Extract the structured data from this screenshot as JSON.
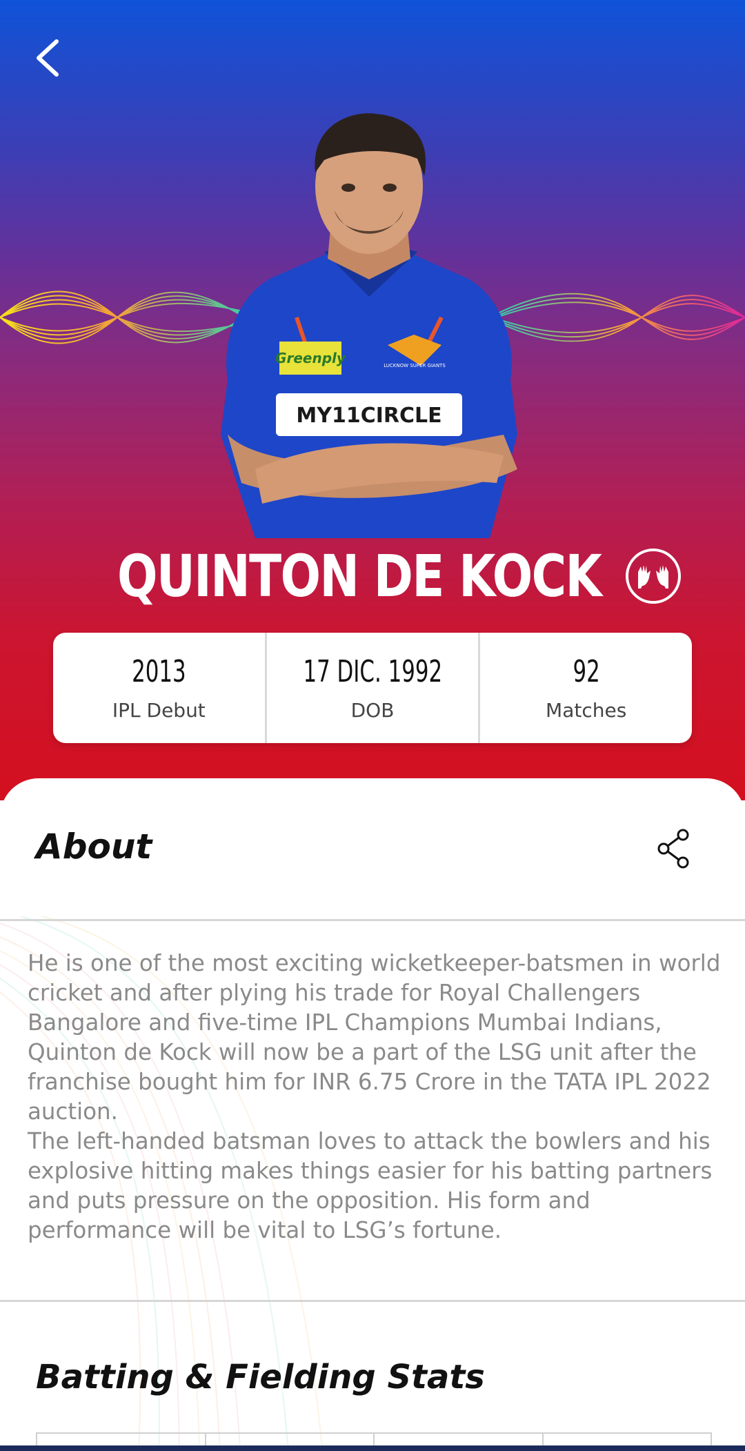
{
  "header": {
    "back_icon": "chevron-left-icon"
  },
  "player": {
    "name": "QUINTON DE KOCK",
    "role_icon": "wicketkeeper-gloves-icon",
    "photo_jersey": {
      "sponsor_1": "Greenply",
      "sponsor_2": "MY11CIRCLE",
      "team_crest": "LUCKNOW SUPER GIANTS"
    }
  },
  "stats": [
    {
      "value": "2013",
      "label": "IPL Debut"
    },
    {
      "value": "17 DIC. 1992",
      "label": "DOB"
    },
    {
      "value": "92",
      "label": "Matches"
    }
  ],
  "about": {
    "title": "About",
    "share_icon": "share-icon",
    "paragraphs": [
      "He is one of the most exciting wicketkeeper-batsmen in world cricket and after plying his trade for Royal Challengers Bangalore and five-time IPL Champions Mumbai Indians, Quinton de Kock will now be a part of the LSG unit after the franchise bought him for INR 6.75 Crore in the TATA IPL 2022 auction.",
      "The left-handed batsman loves to attack the bowlers and his explosive hitting makes things easier for his batting partners and puts pressure on the opposition. His form and performance will be vital to LSG’s fortune."
    ]
  },
  "batting_fielding": {
    "title": "Batting & Fielding Stats"
  },
  "colors": {
    "hero_top": "#0f53d8",
    "hero_mid": "#8c2a7b",
    "hero_bottom": "#d4101f",
    "jersey": "#1e46c8"
  }
}
